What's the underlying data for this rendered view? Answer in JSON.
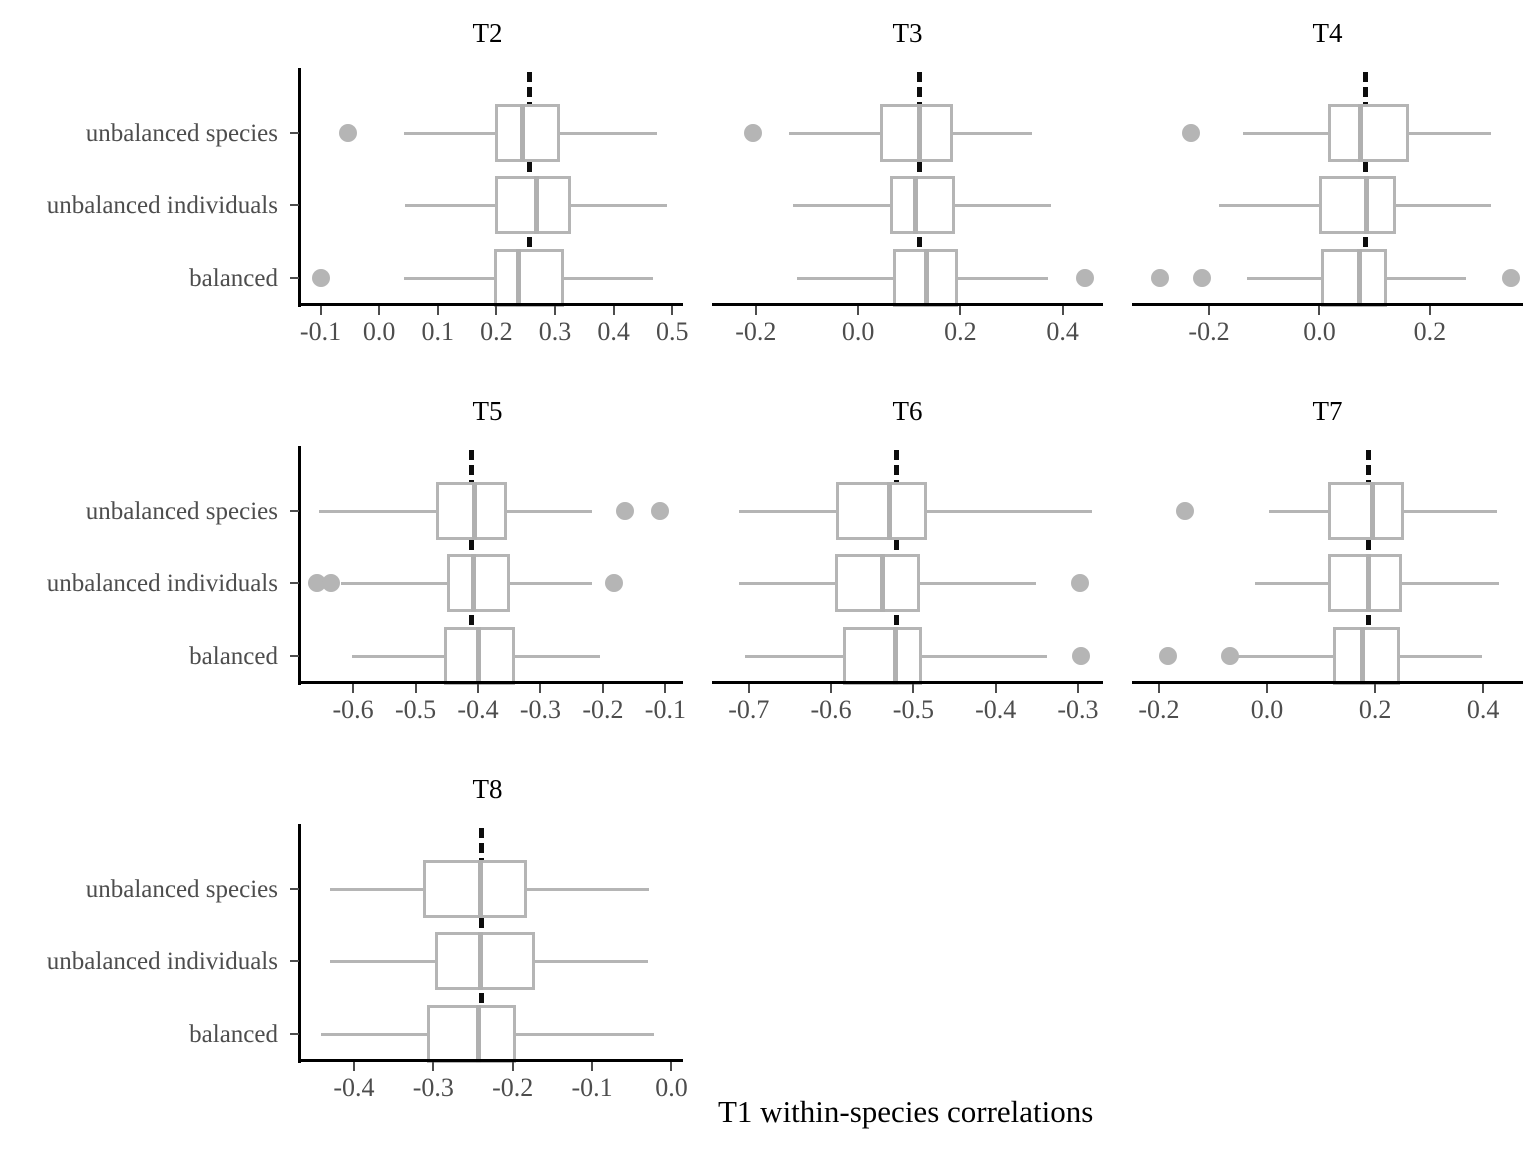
{
  "figure": {
    "xlabel": "T1 within-species correlations",
    "group_labels": [
      "unbalanced species",
      "unbalanced individuals",
      "balanced"
    ],
    "colors": {
      "box_stroke": "#b5b5b5",
      "median": "#b0b0b0",
      "whisker": "#b5b5b5",
      "outlier": "#b5b5b5",
      "refline": "#0d0d0d",
      "axis": "#000000",
      "tick_label": "#4d4d4d",
      "background": "#ffffff"
    }
  },
  "chart_data": {
    "type": "box",
    "title": "",
    "xlabel": "T1 within-species correlations",
    "ylabel": "",
    "orientation": "horizontal",
    "categories": [
      "unbalanced species",
      "unbalanced individuals",
      "balanced"
    ],
    "panels": [
      {
        "title": "T2",
        "xlim": [
          -0.135,
          0.515
        ],
        "xticks": [
          -0.1,
          0.0,
          0.1,
          0.2,
          0.3,
          0.4,
          0.5
        ],
        "xticklabels": [
          "-0.1",
          "0.0",
          "0.1",
          "0.2",
          "0.3",
          "0.4",
          "0.5"
        ],
        "refline": 0.256,
        "boxes": [
          {
            "group": "unbalanced species",
            "whisker_low": 0.043,
            "q1": 0.198,
            "median": 0.245,
            "q3": 0.308,
            "whisker_high": 0.474,
            "outliers": [
              -0.053
            ]
          },
          {
            "group": "unbalanced individuals",
            "whisker_low": 0.044,
            "q1": 0.198,
            "median": 0.268,
            "q3": 0.327,
            "whisker_high": 0.491,
            "outliers": []
          },
          {
            "group": "balanced",
            "whisker_low": 0.043,
            "q1": 0.196,
            "median": 0.238,
            "q3": 0.316,
            "whisker_high": 0.468,
            "outliers": [
              -0.1
            ]
          }
        ]
      },
      {
        "title": "T3",
        "xlim": [
          -0.27,
          0.475
        ],
        "xticks": [
          -0.2,
          0.0,
          0.2,
          0.4
        ],
        "xticklabels": [
          "-0.2",
          "0.0",
          "0.2",
          "0.4"
        ],
        "refline": 0.119,
        "boxes": [
          {
            "group": "unbalanced species",
            "whisker_low": -0.135,
            "q1": 0.042,
            "median": 0.12,
            "q3": 0.185,
            "whisker_high": 0.34,
            "outliers": [
              -0.205
            ]
          },
          {
            "group": "unbalanced individuals",
            "whisker_low": -0.128,
            "q1": 0.062,
            "median": 0.113,
            "q3": 0.19,
            "whisker_high": 0.378,
            "outliers": []
          },
          {
            "group": "balanced",
            "whisker_low": -0.12,
            "q1": 0.068,
            "median": 0.133,
            "q3": 0.196,
            "whisker_high": 0.372,
            "outliers": [
              0.443
            ]
          }
        ]
      },
      {
        "title": "T4",
        "xlim": [
          -0.325,
          0.365
        ],
        "xticks": [
          -0.2,
          0.0,
          0.2
        ],
        "xticklabels": [
          "-0.2",
          "0.0",
          "0.2"
        ],
        "refline": 0.082,
        "boxes": [
          {
            "group": "unbalanced species",
            "whisker_low": -0.139,
            "q1": 0.015,
            "median": 0.075,
            "q3": 0.162,
            "whisker_high": 0.31,
            "outliers": [
              -0.233
            ]
          },
          {
            "group": "unbalanced individuals",
            "whisker_low": -0.182,
            "q1": 0.0,
            "median": 0.085,
            "q3": 0.139,
            "whisker_high": 0.31,
            "outliers": []
          },
          {
            "group": "balanced",
            "whisker_low": -0.132,
            "q1": 0.002,
            "median": 0.073,
            "q3": 0.123,
            "whisker_high": 0.265,
            "outliers": [
              -0.288,
              -0.212,
              0.347
            ]
          }
        ]
      },
      {
        "title": "T5",
        "xlim": [
          -0.685,
          -0.075
        ],
        "xticks": [
          -0.6,
          -0.5,
          -0.4,
          -0.3,
          -0.2,
          -0.1
        ],
        "xticklabels": [
          "-0.6",
          "-0.5",
          "-0.4",
          "-0.3",
          "-0.2",
          "-0.1"
        ],
        "refline": -0.412,
        "boxes": [
          {
            "group": "unbalanced species",
            "whisker_low": -0.655,
            "q1": -0.467,
            "median": -0.405,
            "q3": -0.353,
            "whisker_high": -0.218,
            "outliers": [
              -0.165,
              -0.108
            ]
          },
          {
            "group": "unbalanced individuals",
            "whisker_low": -0.62,
            "q1": -0.45,
            "median": -0.408,
            "q3": -0.348,
            "whisker_high": -0.218,
            "outliers": [
              -0.657,
              -0.635,
              -0.183
            ]
          },
          {
            "group": "balanced",
            "whisker_low": -0.602,
            "q1": -0.455,
            "median": -0.4,
            "q3": -0.34,
            "whisker_high": -0.205,
            "outliers": []
          }
        ]
      },
      {
        "title": "T6",
        "xlim": [
          -0.735,
          -0.272
        ],
        "xticks": [
          -0.7,
          -0.6,
          -0.5,
          -0.4,
          -0.3
        ],
        "xticklabels": [
          "-0.7",
          "-0.6",
          "-0.5",
          "-0.4",
          "-0.3"
        ],
        "refline": -0.521,
        "boxes": [
          {
            "group": "unbalanced species",
            "whisker_low": -0.712,
            "q1": -0.594,
            "median": -0.529,
            "q3": -0.483,
            "whisker_high": -0.283,
            "outliers": []
          },
          {
            "group": "unbalanced individuals",
            "whisker_low": -0.712,
            "q1": -0.595,
            "median": -0.538,
            "q3": -0.492,
            "whisker_high": -0.351,
            "outliers": [
              -0.298
            ]
          },
          {
            "group": "balanced",
            "whisker_low": -0.705,
            "q1": -0.585,
            "median": -0.522,
            "q3": -0.49,
            "whisker_high": -0.338,
            "outliers": [
              -0.296
            ]
          }
        ]
      },
      {
        "title": "T7",
        "xlim": [
          -0.235,
          0.47
        ],
        "xticks": [
          -0.2,
          0.0,
          0.2,
          0.4
        ],
        "xticklabels": [
          "-0.2",
          "0.0",
          "0.2",
          "0.4"
        ],
        "refline": 0.186,
        "boxes": [
          {
            "group": "unbalanced species",
            "whisker_low": 0.003,
            "q1": 0.113,
            "median": 0.196,
            "q3": 0.253,
            "whisker_high": 0.425,
            "outliers": [
              -0.152
            ]
          },
          {
            "group": "unbalanced individuals",
            "whisker_low": -0.022,
            "q1": 0.113,
            "median": 0.188,
            "q3": 0.25,
            "whisker_high": 0.43,
            "outliers": []
          },
          {
            "group": "balanced",
            "whisker_low": -0.068,
            "q1": 0.122,
            "median": 0.176,
            "q3": 0.247,
            "whisker_high": 0.398,
            "outliers": [
              -0.183,
              -0.068
            ]
          }
        ]
      },
      {
        "title": "T8",
        "xlim": [
          -0.468,
          0.012
        ],
        "xticks": [
          -0.4,
          -0.3,
          -0.2,
          -0.1,
          0.0
        ],
        "xticklabels": [
          "-0.4",
          "-0.3",
          "-0.2",
          "-0.1",
          "0.0"
        ],
        "refline": -0.24,
        "boxes": [
          {
            "group": "unbalanced species",
            "whisker_low": -0.43,
            "q1": -0.313,
            "median": -0.24,
            "q3": -0.182,
            "whisker_high": -0.028,
            "outliers": []
          },
          {
            "group": "unbalanced individuals",
            "whisker_low": -0.43,
            "q1": -0.298,
            "median": -0.24,
            "q3": -0.172,
            "whisker_high": -0.03,
            "outliers": []
          },
          {
            "group": "balanced",
            "whisker_low": -0.442,
            "q1": -0.308,
            "median": -0.243,
            "q3": -0.196,
            "whisker_high": -0.022,
            "outliers": []
          }
        ]
      }
    ]
  }
}
